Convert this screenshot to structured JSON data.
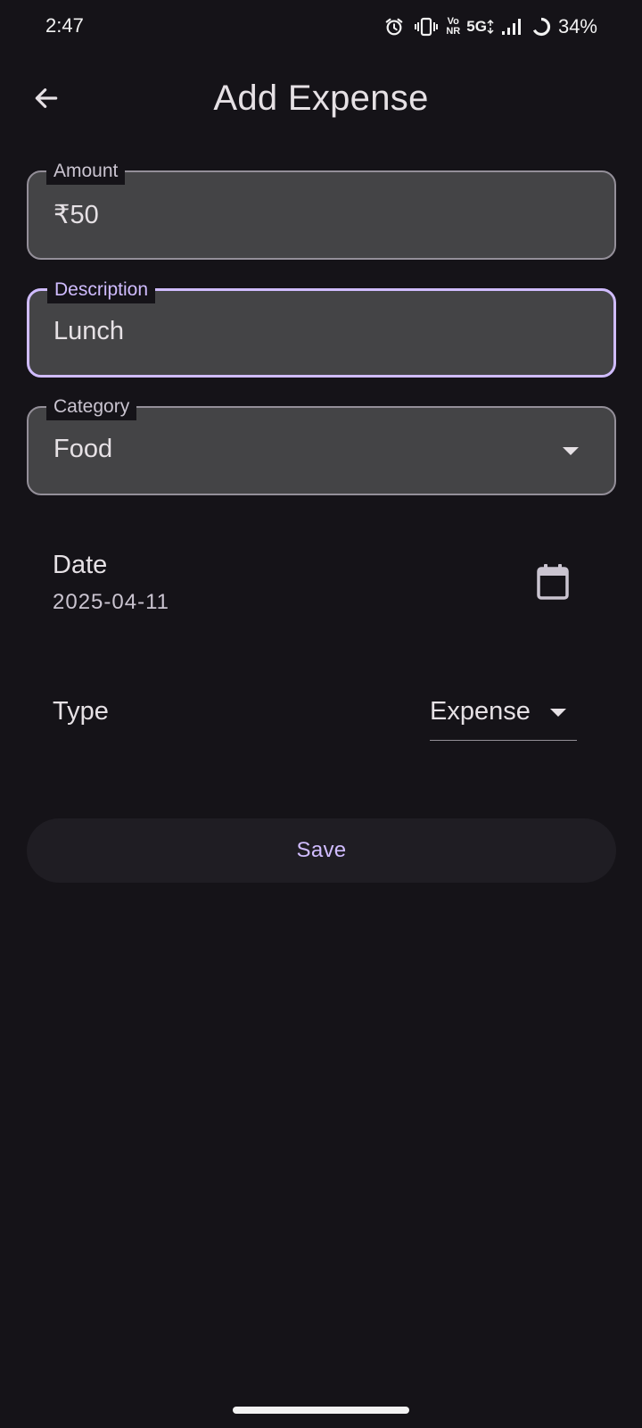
{
  "status_bar": {
    "time": "2:47",
    "network_vo_top": "Vo",
    "network_vo_bottom": "NR",
    "network_type": "5G",
    "battery_percent": "34%",
    "icons": [
      "alarm-icon",
      "vibrate-icon",
      "vonr-icon",
      "5g-icon",
      "signal-icon",
      "battery-saver-icon"
    ]
  },
  "app_bar": {
    "back_icon": "arrow-back-icon",
    "title": "Add Expense"
  },
  "form": {
    "amount": {
      "label": "Amount",
      "value": "₹50"
    },
    "description": {
      "label": "Description",
      "value": "Lunch",
      "focused": true
    },
    "category": {
      "label": "Category",
      "value": "Food",
      "icon": "dropdown-arrow-icon"
    },
    "date": {
      "label": "Date",
      "value": "2025-04-11",
      "icon": "calendar-icon"
    },
    "type": {
      "label": "Type",
      "value": "Expense",
      "icon": "dropdown-arrow-icon"
    },
    "save_label": "Save"
  },
  "colors": {
    "background": "#151318",
    "field_fill": "#444446",
    "field_border": "#948f99",
    "focus_accent": "#d0bcff",
    "button_bg": "#1f1d23",
    "text_primary": "#e6e1e5",
    "text_secondary": "#cac4d0"
  }
}
